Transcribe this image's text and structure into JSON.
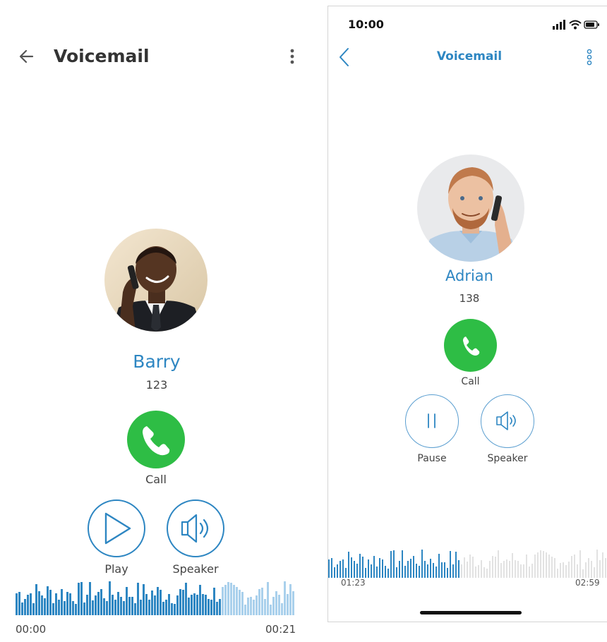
{
  "android": {
    "header": {
      "title": "Voicemail",
      "back_icon": "arrow-left-icon",
      "menu_icon": "more-vertical-icon"
    },
    "contact": {
      "name": "Barry",
      "extension": "123"
    },
    "actions": {
      "call_label": "Call",
      "play_label": "Play",
      "speaker_label": "Speaker"
    },
    "playback": {
      "current_time": "00:00",
      "total_time": "00:21",
      "progress": 0.73
    }
  },
  "ios": {
    "status_bar": {
      "time": "10:00"
    },
    "header": {
      "title": "Voicemail",
      "back_icon": "chevron-left-icon",
      "menu_icon": "more-vertical-icon"
    },
    "contact": {
      "name": "Adrian",
      "extension": "138"
    },
    "actions": {
      "call_label": "Call",
      "pause_label": "Pause",
      "speaker_label": "Speaker"
    },
    "playback": {
      "current_time": "01:23",
      "total_time": "02:59",
      "progress": 0.47
    }
  },
  "colors": {
    "accent": "#2d86c2",
    "call_green": "#2ebd45",
    "wave_played": "#2d86c2",
    "wave_remaining_android": "#a9d0ec",
    "wave_remaining_ios": "#e2e2e2"
  }
}
